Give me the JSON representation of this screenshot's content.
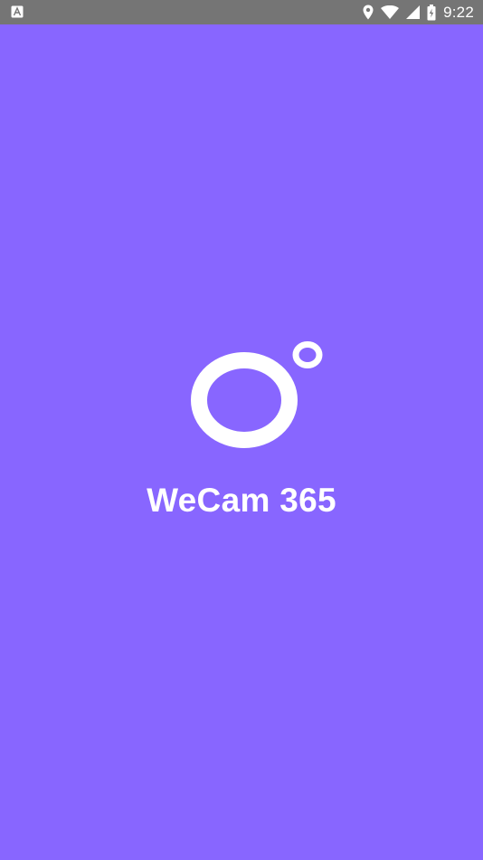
{
  "status_bar": {
    "time": "9:22",
    "icons": [
      "notification-a-icon",
      "location-pin-icon",
      "wifi-icon",
      "cellular-signal-icon",
      "battery-charging-icon"
    ]
  },
  "splash": {
    "app_name": "WeCam 365",
    "logo": "wecam-logo-icon"
  },
  "colors": {
    "background": "#8866ff",
    "status_bar": "#757575",
    "foreground": "#ffffff"
  }
}
